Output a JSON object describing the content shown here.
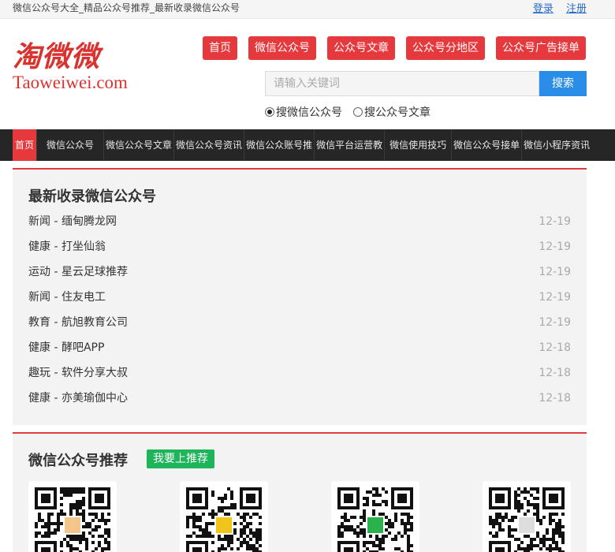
{
  "topbar": {
    "tagline": "微信公众号大全_精品公众号推荐_最新收录微信公众号",
    "login": "登录",
    "register": "注册"
  },
  "logo": {
    "cn": "淘微微",
    "en": "Taoweiwei.com"
  },
  "topnav": [
    "首页",
    "微信公众号",
    "公众号文章",
    "公众号分地区",
    "公众号广告接单"
  ],
  "search": {
    "placeholder": "请输入关键词",
    "button": "搜索",
    "options": [
      {
        "label": "搜微信公众号",
        "checked": true
      },
      {
        "label": "搜公众号文章",
        "checked": false
      }
    ]
  },
  "mainnav": [
    "首页",
    "微信公众号",
    "微信公众号文章",
    "微信公众号资讯",
    "微信公众账号推",
    "微信平台运营教",
    "微信使用技巧",
    "微信公众号接单",
    "微信小程序资讯"
  ],
  "latest": {
    "title": "最新收录微信公众号",
    "items": [
      {
        "text": "新闻 - 缅甸腾龙网",
        "date": "12-19"
      },
      {
        "text": "健康 - 打坐仙翁",
        "date": "12-19"
      },
      {
        "text": "运动 - 星云足球推荐",
        "date": "12-19"
      },
      {
        "text": "新闻 - 住友电工",
        "date": "12-19"
      },
      {
        "text": "教育 - 航旭教育公司",
        "date": "12-19"
      },
      {
        "text": "健康 - 酵吧APP",
        "date": "12-18"
      },
      {
        "text": "趣玩 - 软件分享大叔",
        "date": "12-18"
      },
      {
        "text": "健康 - 亦美瑜伽中心",
        "date": "12-18"
      }
    ]
  },
  "recommend": {
    "title": "微信公众号推荐",
    "button": "我要上推荐",
    "qrcodes": [
      {
        "icon": "qr-code-icon",
        "center_color": "#f2c58a"
      },
      {
        "icon": "qr-code-icon",
        "center_color": "#f0c419"
      },
      {
        "icon": "qr-code-icon",
        "center_color": "#2bb24c"
      },
      {
        "icon": "qr-code-icon",
        "center_color": "#dddddd"
      }
    ]
  },
  "colors": {
    "accent": "#e6393e",
    "search": "#2a8ee8",
    "green": "#1db45a",
    "nav_bg": "#262626"
  }
}
